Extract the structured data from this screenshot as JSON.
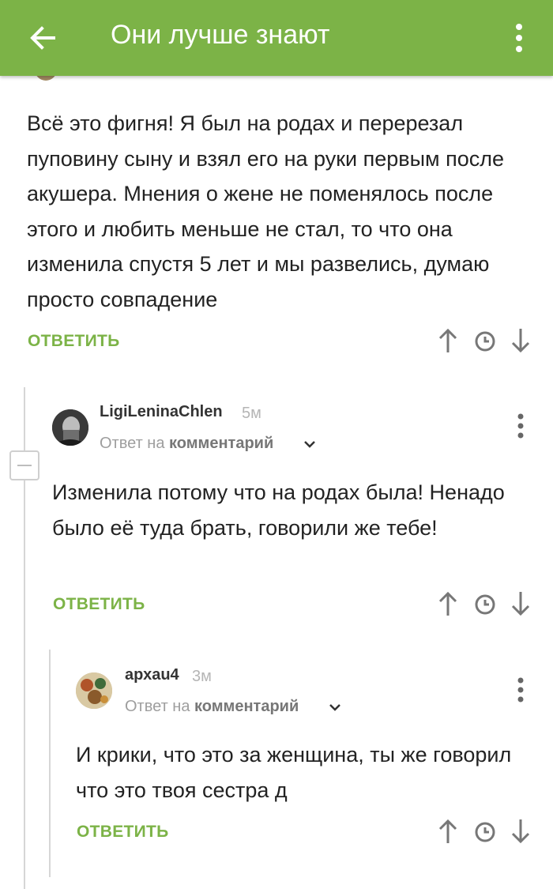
{
  "appbar": {
    "title": "Они лучше знают",
    "back_icon": "arrow-left-icon",
    "menu_icon": "more-vert-icon",
    "color": "#7cb347"
  },
  "comment_top": {
    "text": "Всё это фигня! Я был на родах и перерезал пуповину сыну и взял его на руки первым после акушера. Мнения о жене не поменялось после этого и любить меньше не стал, то что она изменила спустя 5 лет и мы развелись, думаю просто совпадение",
    "reply_label": "ОТВЕТИТЬ"
  },
  "comment_1": {
    "author": "LigiLeninaChlen",
    "time": "5м",
    "reply_to_prefix": "Ответ на",
    "reply_to_link": "комментарий",
    "text": "Изменила потому что на родах была! Ненадо было её туда брать, говорили же тебе!",
    "reply_label": "ОТВЕТИТЬ"
  },
  "comment_2": {
    "author": "архаu4",
    "time": "3м",
    "reply_to_prefix": "Ответ на",
    "reply_to_link": "комментарий",
    "text": "И крики, что это за женщина, ты же говорил что это твоя сестра д",
    "reply_label": "ОТВЕТИТЬ"
  },
  "accent_color": "#7cb347"
}
